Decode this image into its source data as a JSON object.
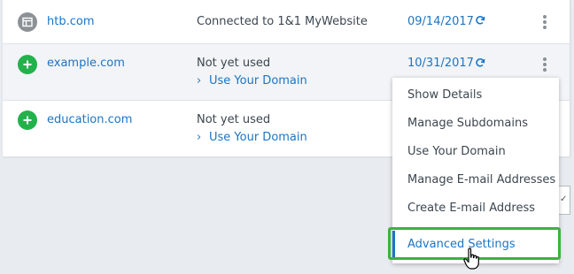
{
  "domains": [
    {
      "name": "htb.com",
      "status": "Connected to 1&1 MyWebsite",
      "date": "09/14/2017",
      "icon": "website-icon"
    },
    {
      "name": "example.com",
      "status": "Not yet used",
      "link": "Use Your Domain",
      "date": "10/31/2017",
      "icon": "plus-icon"
    },
    {
      "name": "education.com",
      "status": "Not yet used",
      "link": "Use Your Domain",
      "icon": "plus-icon"
    }
  ],
  "menu": {
    "items": [
      "Show Details",
      "Manage Subdomains",
      "Use Your Domain",
      "Manage E-mail Addresses",
      "Create E-mail Address",
      "Advanced Settings"
    ]
  },
  "colors": {
    "link": "#1b75c4",
    "green": "#22b24c",
    "highlight": "#3bb33d"
  }
}
